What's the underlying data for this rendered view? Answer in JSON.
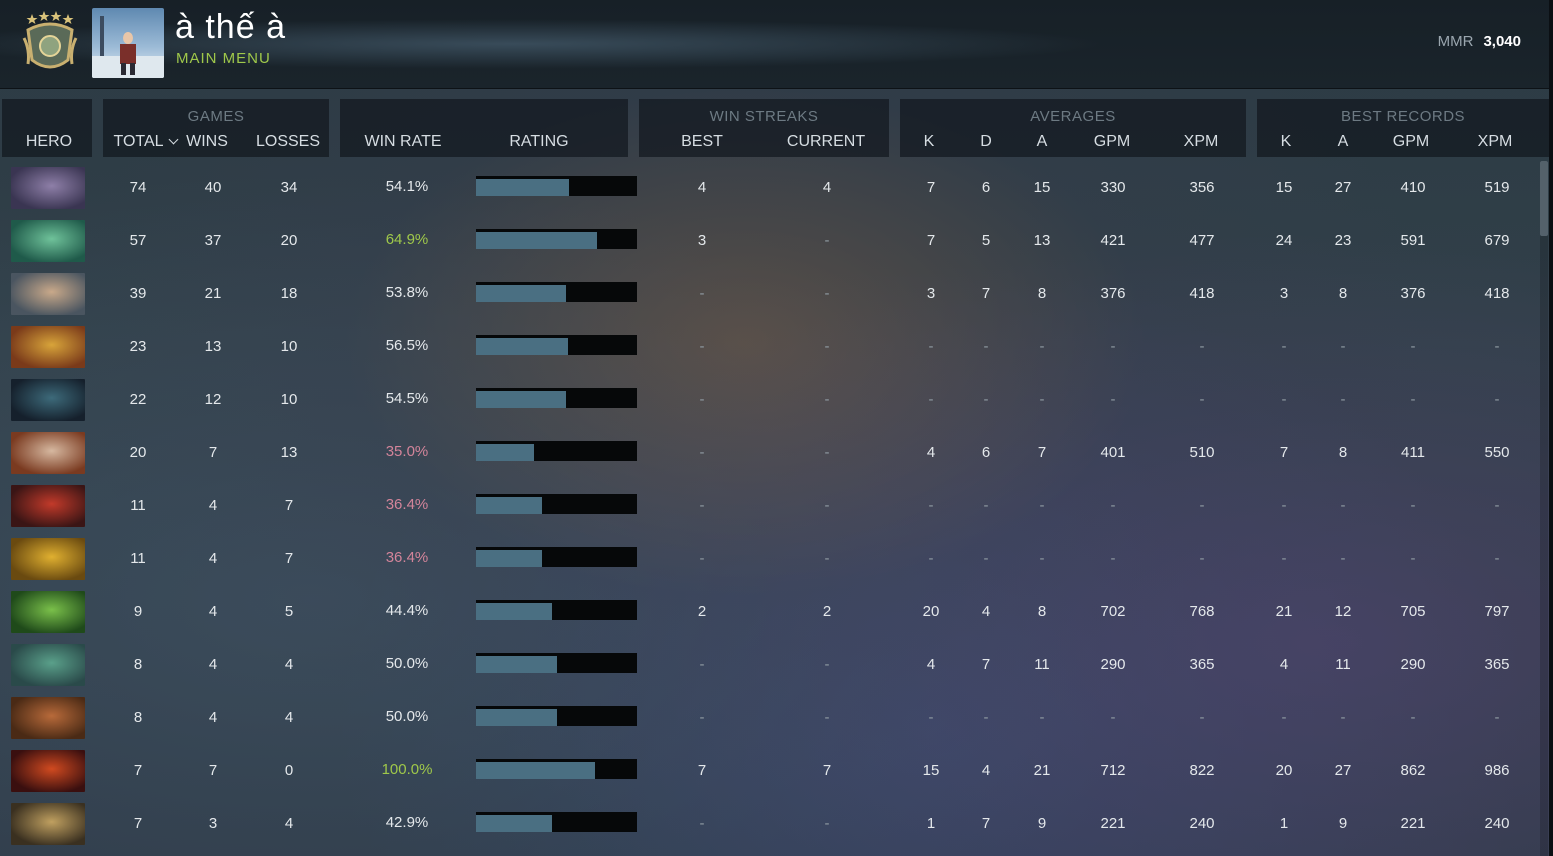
{
  "header": {
    "player_name": "à thế à",
    "menu_label": "MAIN MENU",
    "mmr_label": "MMR",
    "mmr_value": "3,040"
  },
  "column_groups": {
    "games": "GAMES",
    "win_streaks": "WIN STREAKS",
    "averages": "AVERAGES",
    "best_records": "BEST RECORDS"
  },
  "columns": {
    "hero": "HERO",
    "total": "TOTAL",
    "wins": "WINS",
    "losses": "LOSSES",
    "win_rate": "WIN RATE",
    "rating": "RATING",
    "best": "BEST",
    "current": "CURRENT",
    "avg_k": "K",
    "avg_d": "D",
    "avg_a": "A",
    "avg_gpm": "GPM",
    "avg_xpm": "XPM",
    "best_k": "K",
    "best_a": "A",
    "best_gpm": "GPM",
    "best_xpm": "XPM"
  },
  "colors": {
    "win_rate_high": "#9fc84a",
    "win_rate_low": "#d3849a",
    "win_rate_mid": "#e4e8eb",
    "rating_bar": "#4a6f82"
  },
  "rows": [
    {
      "hero_icon": "purple-hero-portrait",
      "total": "74",
      "wins": "40",
      "losses": "34",
      "win_rate": "54.1%",
      "rating": 0.58,
      "tone": "mid",
      "best": "4",
      "current": "4",
      "k": "7",
      "d": "6",
      "a": "15",
      "gpm": "330",
      "xpm": "356",
      "bk": "15",
      "ba": "27",
      "bgpm": "410",
      "bxpm": "519"
    },
    {
      "hero_icon": "green-ogre-hero-portrait",
      "total": "57",
      "wins": "37",
      "losses": "20",
      "win_rate": "64.9%",
      "rating": 0.75,
      "tone": "high",
      "best": "3",
      "current": "-",
      "k": "7",
      "d": "5",
      "a": "13",
      "gpm": "421",
      "xpm": "477",
      "bk": "24",
      "ba": "23",
      "bgpm": "591",
      "bxpm": "679"
    },
    {
      "hero_icon": "goblin-hero-portrait",
      "total": "39",
      "wins": "21",
      "losses": "18",
      "win_rate": "53.8%",
      "rating": 0.56,
      "tone": "mid",
      "best": "-",
      "current": "-",
      "k": "3",
      "d": "7",
      "a": "8",
      "gpm": "376",
      "xpm": "418",
      "bk": "3",
      "ba": "8",
      "bgpm": "376",
      "bxpm": "418"
    },
    {
      "hero_icon": "masked-hero-portrait",
      "total": "23",
      "wins": "13",
      "losses": "10",
      "win_rate": "56.5%",
      "rating": 0.57,
      "tone": "mid",
      "best": "-",
      "current": "-",
      "k": "-",
      "d": "-",
      "a": "-",
      "gpm": "-",
      "xpm": "-",
      "bk": "-",
      "ba": "-",
      "bgpm": "-",
      "bxpm": "-"
    },
    {
      "hero_icon": "dark-hero-portrait",
      "total": "22",
      "wins": "12",
      "losses": "10",
      "win_rate": "54.5%",
      "rating": 0.56,
      "tone": "mid",
      "best": "-",
      "current": "-",
      "k": "-",
      "d": "-",
      "a": "-",
      "gpm": "-",
      "xpm": "-",
      "bk": "-",
      "ba": "-",
      "bgpm": "-",
      "bxpm": "-"
    },
    {
      "hero_icon": "horned-hero-portrait",
      "total": "20",
      "wins": "7",
      "losses": "13",
      "win_rate": "35.0%",
      "rating": 0.36,
      "tone": "low",
      "best": "-",
      "current": "-",
      "k": "4",
      "d": "6",
      "a": "7",
      "gpm": "401",
      "xpm": "510",
      "bk": "7",
      "ba": "8",
      "bgpm": "411",
      "bxpm": "550"
    },
    {
      "hero_icon": "red-demon-hero-portrait",
      "total": "11",
      "wins": "4",
      "losses": "7",
      "win_rate": "36.4%",
      "rating": 0.41,
      "tone": "low",
      "best": "-",
      "current": "-",
      "k": "-",
      "d": "-",
      "a": "-",
      "gpm": "-",
      "xpm": "-",
      "bk": "-",
      "ba": "-",
      "bgpm": "-",
      "bxpm": "-"
    },
    {
      "hero_icon": "golden-hero-portrait",
      "total": "11",
      "wins": "4",
      "losses": "7",
      "win_rate": "36.4%",
      "rating": 0.41,
      "tone": "low",
      "best": "-",
      "current": "-",
      "k": "-",
      "d": "-",
      "a": "-",
      "gpm": "-",
      "xpm": "-",
      "bk": "-",
      "ba": "-",
      "bgpm": "-",
      "bxpm": "-"
    },
    {
      "hero_icon": "green-beast-hero-portrait",
      "total": "9",
      "wins": "4",
      "losses": "5",
      "win_rate": "44.4%",
      "rating": 0.47,
      "tone": "mid",
      "best": "2",
      "current": "2",
      "k": "20",
      "d": "4",
      "a": "8",
      "gpm": "702",
      "xpm": "768",
      "bk": "21",
      "ba": "12",
      "bgpm": "705",
      "bxpm": "797"
    },
    {
      "hero_icon": "lizard-hero-portrait",
      "total": "8",
      "wins": "4",
      "losses": "4",
      "win_rate": "50.0%",
      "rating": 0.5,
      "tone": "mid",
      "best": "-",
      "current": "-",
      "k": "4",
      "d": "7",
      "a": "11",
      "gpm": "290",
      "xpm": "365",
      "bk": "4",
      "ba": "11",
      "bgpm": "290",
      "bxpm": "365"
    },
    {
      "hero_icon": "brute-hero-portrait",
      "total": "8",
      "wins": "4",
      "losses": "4",
      "win_rate": "50.0%",
      "rating": 0.5,
      "tone": "mid",
      "best": "-",
      "current": "-",
      "k": "-",
      "d": "-",
      "a": "-",
      "gpm": "-",
      "xpm": "-",
      "bk": "-",
      "ba": "-",
      "bgpm": "-",
      "bxpm": "-"
    },
    {
      "hero_icon": "fire-hero-portrait",
      "total": "7",
      "wins": "7",
      "losses": "0",
      "win_rate": "100.0%",
      "rating": 0.74,
      "tone": "high",
      "best": "7",
      "current": "7",
      "k": "15",
      "d": "4",
      "a": "21",
      "gpm": "712",
      "xpm": "822",
      "bk": "20",
      "ba": "27",
      "bgpm": "862",
      "bxpm": "986"
    },
    {
      "hero_icon": "armored-hero-portrait",
      "total": "7",
      "wins": "3",
      "losses": "4",
      "win_rate": "42.9%",
      "rating": 0.47,
      "tone": "mid",
      "best": "-",
      "current": "-",
      "k": "1",
      "d": "7",
      "a": "9",
      "gpm": "221",
      "xpm": "240",
      "bk": "1",
      "ba": "9",
      "bgpm": "221",
      "bxpm": "240"
    }
  ]
}
